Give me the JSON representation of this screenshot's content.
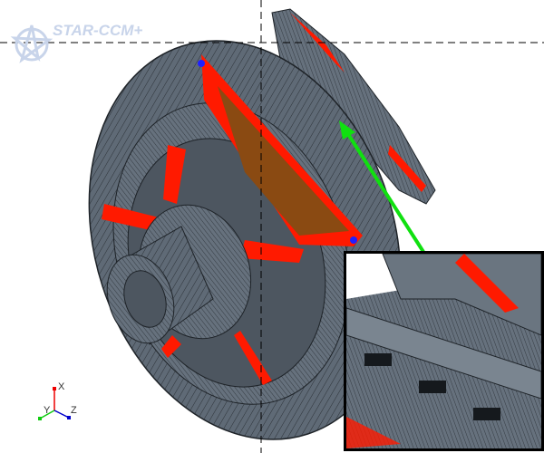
{
  "app": {
    "logo_text": "STAR-CCM+"
  },
  "axes": {
    "x_label": "X",
    "y_label": "Y",
    "z_label": "Z"
  },
  "colors": {
    "mesh": "#5f6a76",
    "edge": "#1e2328",
    "highlight": "#ff1a00",
    "face": "#8a4a12",
    "arrow": "#10e010"
  }
}
